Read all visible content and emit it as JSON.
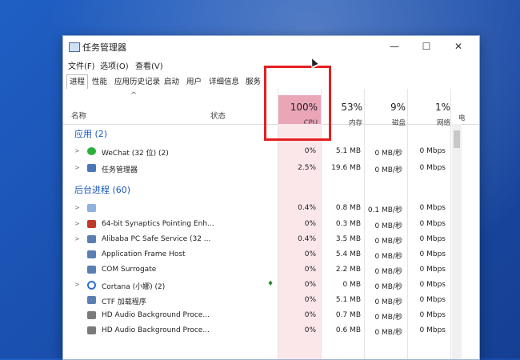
{
  "window": {
    "title": "任务管理器",
    "minimize": "—",
    "maximize": "☐",
    "close": "✕"
  },
  "menu": [
    "文件(F)",
    "选项(O)",
    "查看(V)"
  ],
  "tabs": [
    "进程",
    "性能",
    "应用历史记录",
    "启动",
    "用户",
    "详细信息",
    "服务"
  ],
  "header": {
    "sort_arrow": "^",
    "name_label": "名称",
    "status_label": "状态",
    "cpu_pct": "100%",
    "cpu_label": "CPU",
    "mem_pct": "53%",
    "mem_label": "内存",
    "disk_pct": "9%",
    "disk_label": "磁盘",
    "net_pct": "1%",
    "net_label": "网络",
    "extra_label": "电"
  },
  "sections": {
    "apps": "应用 (2)",
    "background": "后台进程 (60)"
  },
  "apps": [
    {
      "name": "WeChat (32 位) (2)",
      "cpu": "0%",
      "mem": "5.1 MB",
      "disk": "0 MB/秒",
      "net": "0 Mbps",
      "icon_color": "#2fae3b"
    },
    {
      "name": "任务管理器",
      "cpu": "2.5%",
      "mem": "19.6 MB",
      "disk": "0 MB/秒",
      "net": "0 Mbps",
      "icon_color": "#4a78b8"
    }
  ],
  "background": [
    {
      "name": "",
      "cpu": "0.4%",
      "mem": "0.8 MB",
      "disk": "0.1 MB/秒",
      "net": "0 Mbps",
      "icon_color": "#8fb1dd"
    },
    {
      "name": "64-bit Synaptics Pointing Enh...",
      "cpu": "0%",
      "mem": "0.3 MB",
      "disk": "0 MB/秒",
      "net": "0 Mbps",
      "icon_color": "#c0392b"
    },
    {
      "name": "Alibaba PC Safe Service (32 ...",
      "cpu": "0.4%",
      "mem": "3.5 MB",
      "disk": "0 MB/秒",
      "net": "0 Mbps",
      "icon_color": "#5a7fb0"
    },
    {
      "name": "Application Frame Host",
      "cpu": "0%",
      "mem": "5.4 MB",
      "disk": "0 MB/秒",
      "net": "0 Mbps",
      "icon_color": "#5a7fb0"
    },
    {
      "name": "COM Surrogate",
      "cpu": "0%",
      "mem": "2.2 MB",
      "disk": "0 MB/秒",
      "net": "0 Mbps",
      "icon_color": "#5a7fb0"
    },
    {
      "name": "Cortana (小娜) (2)",
      "cpu": "0%",
      "mem": "0 MB",
      "disk": "0 MB/秒",
      "net": "0 Mbps",
      "icon_color": "#2b6fd6"
    },
    {
      "name": "CTF 加载程序",
      "cpu": "0%",
      "mem": "5.1 MB",
      "disk": "0 MB/秒",
      "net": "0 Mbps",
      "icon_color": "#5a7fb0"
    },
    {
      "name": "HD Audio Background Proce...",
      "cpu": "0%",
      "mem": "0.7 MB",
      "disk": "0 MB/秒",
      "net": "0 Mbps",
      "icon_color": "#7a7a7a"
    },
    {
      "name": "HD Audio Background Proce...",
      "cpu": "0%",
      "mem": "0.6 MB",
      "disk": "0 MB/秒",
      "net": "0 Mbps",
      "icon_color": "#7a7a7a"
    }
  ],
  "colors": {
    "cpu_highlight": "#eaa6b6",
    "annotation": "#e41f1f",
    "section_text": "#1a57b8"
  }
}
